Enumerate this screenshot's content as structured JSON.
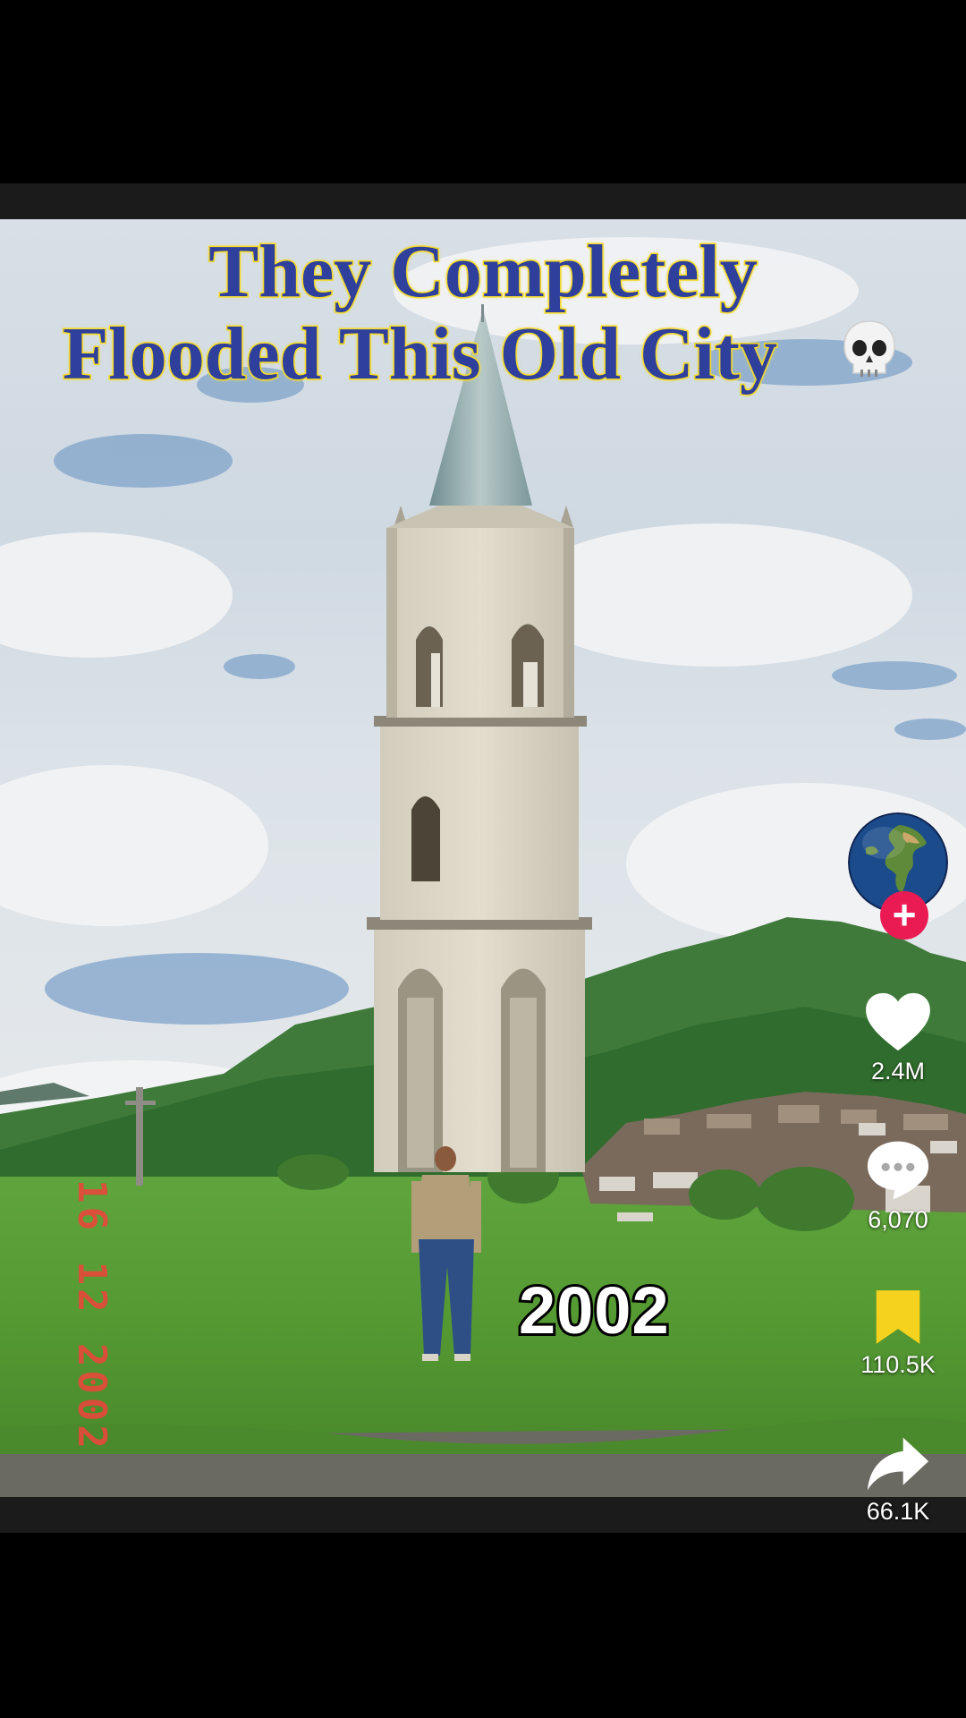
{
  "video": {
    "headline_line1": "They Completely",
    "headline_line2": "Flooded This Old City",
    "headline_emoji": "skull-emoji",
    "year_caption": "2002",
    "date_stamp": "16 12 2002"
  },
  "creator": {
    "avatar": "earth-globe",
    "follow_label": "+"
  },
  "actions": {
    "likes": "2.4M",
    "comments": "6,070",
    "saves": "110.5K",
    "shares": "66.1K"
  },
  "colors": {
    "headline_fill": "#2f3f9c",
    "headline_outline": "#f2d61c",
    "follow_badge": "#ea1b53",
    "bookmark": "#f5d21e",
    "date_stamp": "#e8483a"
  },
  "icons": [
    "heart-icon",
    "comment-icon",
    "bookmark-icon",
    "share-icon",
    "plus-icon",
    "skull-icon"
  ]
}
